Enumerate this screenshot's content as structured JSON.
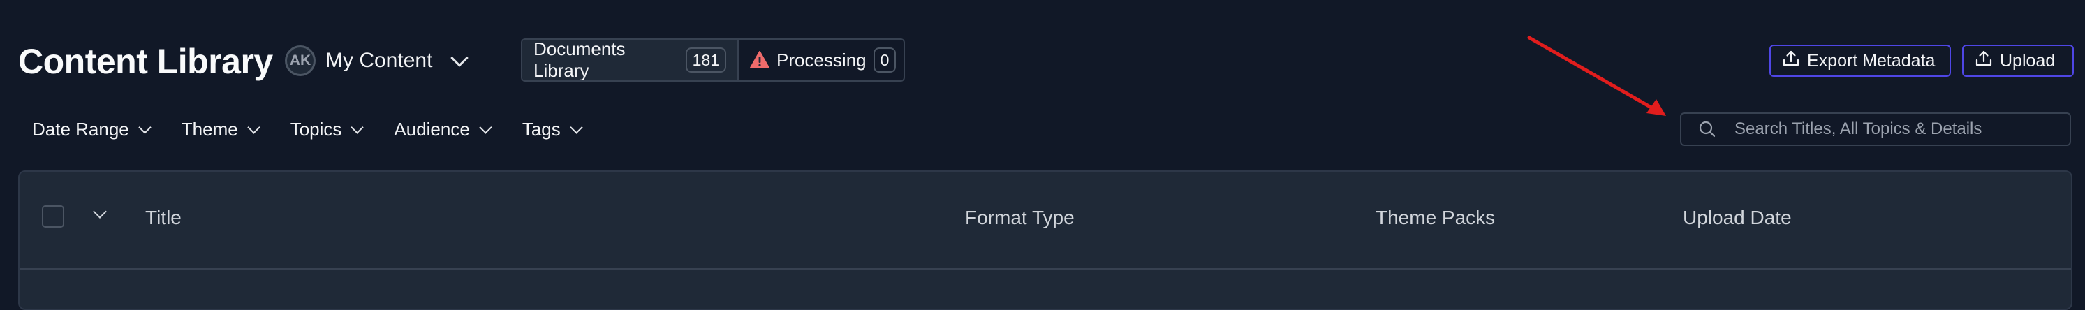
{
  "header": {
    "title": "Content Library",
    "avatar_initials": "AK",
    "scope_label": "My Content"
  },
  "segments": [
    {
      "label": "Documents Library",
      "count": "181",
      "active": true
    },
    {
      "label": "Processing",
      "count": "0",
      "icon": "warning-icon",
      "active": false
    }
  ],
  "actions": {
    "export_label": "Export Metadata",
    "upload_label": "Upload"
  },
  "filters": [
    "Date Range",
    "Theme",
    "Topics",
    "Audience",
    "Tags"
  ],
  "search": {
    "placeholder": "Search Titles, All Topics & Details",
    "value": ""
  },
  "table": {
    "columns": [
      "Title",
      "Format Type",
      "Theme Packs",
      "Upload Date"
    ]
  },
  "colors": {
    "background": "#111827",
    "surface": "#1f2937",
    "accent": "#4f46e5",
    "warning": "#ef4444",
    "annotation": "#e11d1d"
  }
}
